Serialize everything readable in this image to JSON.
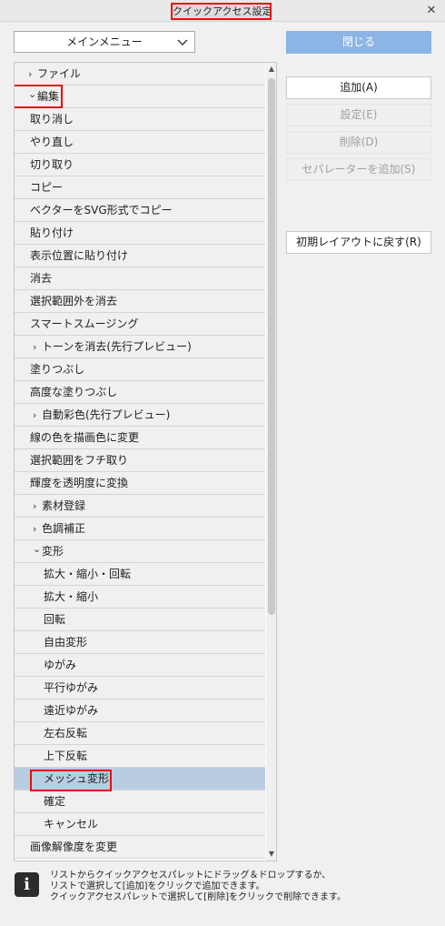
{
  "window": {
    "title": "クイックアクセス設定",
    "close_glyph": "✕"
  },
  "menu_select": {
    "value": "メインメニュー"
  },
  "tree": {
    "items": [
      {
        "label": "ファイル",
        "level": 0,
        "twisty": "collapsed"
      },
      {
        "label": "編集",
        "level": 0,
        "twisty": "expanded"
      },
      {
        "label": "取り消し",
        "level": 1,
        "twisty": "none"
      },
      {
        "label": "やり直し",
        "level": 1,
        "twisty": "none"
      },
      {
        "label": "切り取り",
        "level": 1,
        "twisty": "none"
      },
      {
        "label": "コピー",
        "level": 1,
        "twisty": "none"
      },
      {
        "label": "ベクターをSVG形式でコピー",
        "level": 1,
        "twisty": "none"
      },
      {
        "label": "貼り付け",
        "level": 1,
        "twisty": "none"
      },
      {
        "label": "表示位置に貼り付け",
        "level": 1,
        "twisty": "none"
      },
      {
        "label": "消去",
        "level": 1,
        "twisty": "none"
      },
      {
        "label": "選択範囲外を消去",
        "level": 1,
        "twisty": "none"
      },
      {
        "label": "スマートスムージング",
        "level": 1,
        "twisty": "none"
      },
      {
        "label": "トーンを消去(先行プレビュー)",
        "level": 1,
        "twisty": "collapsed"
      },
      {
        "label": "塗りつぶし",
        "level": 1,
        "twisty": "none"
      },
      {
        "label": "高度な塗りつぶし",
        "level": 1,
        "twisty": "none"
      },
      {
        "label": "自動彩色(先行プレビュー)",
        "level": 1,
        "twisty": "collapsed"
      },
      {
        "label": "線の色を描画色に変更",
        "level": 1,
        "twisty": "none"
      },
      {
        "label": "選択範囲をフチ取り",
        "level": 1,
        "twisty": "none"
      },
      {
        "label": "輝度を透明度に変換",
        "level": 1,
        "twisty": "none"
      },
      {
        "label": "素材登録",
        "level": 1,
        "twisty": "collapsed"
      },
      {
        "label": "色調補正",
        "level": 1,
        "twisty": "collapsed"
      },
      {
        "label": "変形",
        "level": 1,
        "twisty": "expanded"
      },
      {
        "label": "拡大・縮小・回転",
        "level": 2,
        "twisty": "none"
      },
      {
        "label": "拡大・縮小",
        "level": 2,
        "twisty": "none"
      },
      {
        "label": "回転",
        "level": 2,
        "twisty": "none"
      },
      {
        "label": "自由変形",
        "level": 2,
        "twisty": "none"
      },
      {
        "label": "ゆがみ",
        "level": 2,
        "twisty": "none"
      },
      {
        "label": "平行ゆがみ",
        "level": 2,
        "twisty": "none"
      },
      {
        "label": "遠近ゆがみ",
        "level": 2,
        "twisty": "none"
      },
      {
        "label": "左右反転",
        "level": 2,
        "twisty": "none"
      },
      {
        "label": "上下反転",
        "level": 2,
        "twisty": "none"
      },
      {
        "label": "メッシュ変形",
        "level": 2,
        "twisty": "none",
        "selected": true
      },
      {
        "label": "確定",
        "level": 2,
        "twisty": "none"
      },
      {
        "label": "キャンセル",
        "level": 2,
        "twisty": "none"
      },
      {
        "label": "画像解像度を変更",
        "level": 1,
        "twisty": "none"
      }
    ]
  },
  "buttons": {
    "close": "閉じる",
    "add": "追加(A)",
    "settings": "設定(E)",
    "delete": "削除(D)",
    "add_separator": "セパレーターを追加(S)",
    "reset_layout": "初期レイアウトに戻す(R)"
  },
  "info": {
    "icon": "i",
    "lines": [
      "リストからクイックアクセスパレットにドラッグ＆ドロップするか、",
      "リストで選択して[追加]をクリックで追加できます。",
      "クイックアクセスパレットで選択して[削除]をクリックで削除できます。"
    ]
  },
  "colors": {
    "highlight_border": "#e81010",
    "selected_row": "#b9cde2",
    "primary_button": "#8cb4e4"
  }
}
